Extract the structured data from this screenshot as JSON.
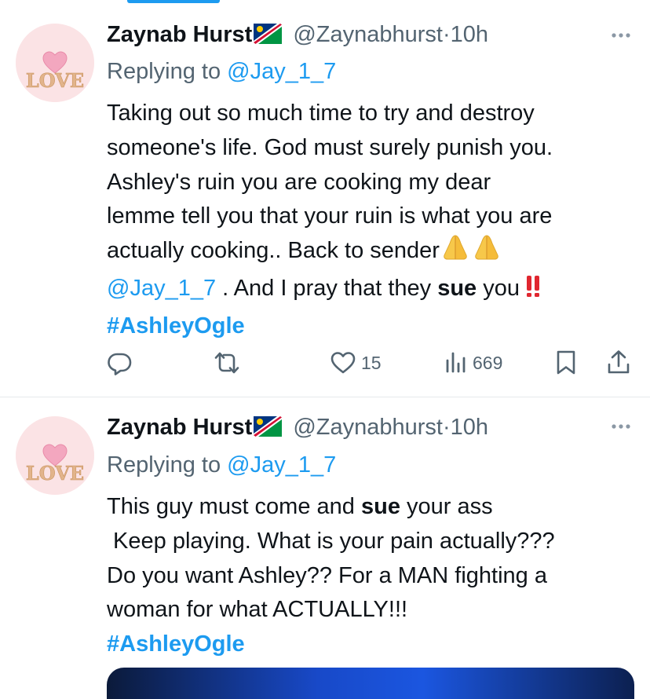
{
  "colors": {
    "link": "#1d9bf0",
    "secondary": "#536471",
    "text": "#0f1419",
    "divider": "#e6e9ec"
  },
  "tweets": [
    {
      "author": {
        "name": "Zaynab Hurst",
        "handle": "@Zaynabhurst",
        "avatar_text": "LOVE",
        "flag": "namibia-flag"
      },
      "dot": "·",
      "time": "10h",
      "reply_prefix": "Replying to",
      "reply_to": "@Jay_1_7",
      "body": {
        "line1": "Taking out so much time to try and destroy",
        "line2": "someone's life. God must surely punish you.",
        "line3": "Ashley's ruin you are cooking my dear",
        "line4": "lemme tell you that your ruin is what you are",
        "line5": "actually cooking.. Back to sender",
        "mention": "@Jay_1_7",
        "line6_text": " . And I pray that they ",
        "bold_word": "sue",
        "line6_tail": " you",
        "hashtag": "#AshleyOgle"
      },
      "stats": {
        "replies": "",
        "reposts": "",
        "likes": "15",
        "views": "669"
      }
    },
    {
      "author": {
        "name": "Zaynab Hurst",
        "handle": "@Zaynabhurst",
        "avatar_text": "LOVE",
        "flag": "namibia-flag"
      },
      "dot": "·",
      "time": "10h",
      "reply_prefix": "Replying to",
      "reply_to": "@Jay_1_7",
      "body": {
        "line1_pre": "This guy must come and ",
        "bold_word": "sue",
        "line1_post": " your ass",
        "line2": " Keep playing. What is your pain actually???",
        "line3": "Do you want Ashley?? For a MAN fighting a",
        "line4": "woman for what ACTUALLY!!!",
        "hashtag": "#AshleyOgle"
      }
    }
  ]
}
